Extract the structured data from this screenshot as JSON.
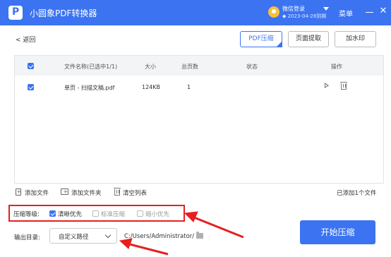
{
  "window": {
    "app_title": "小圆象PDF转换器",
    "user": {
      "login_text": "微信登录",
      "expire_text": "◆ 2023-04-28到期"
    },
    "menu_label": "菜单",
    "close_glyph": "✕"
  },
  "toolbar": {
    "back_label": "< 返回",
    "tabs": [
      {
        "label": "PDF压缩",
        "active": true
      },
      {
        "label": "页面提取",
        "active": false
      },
      {
        "label": "加水印",
        "active": false
      }
    ]
  },
  "table": {
    "columns": [
      "文件名称(已选中1/1)",
      "大小",
      "总页数",
      "状态",
      "操作"
    ],
    "rows": [
      {
        "checked": true,
        "name": "单页 - 扫描文稿.pdf",
        "size": "124KB",
        "pages": "1",
        "status": ""
      }
    ]
  },
  "file_actions": {
    "add_file": "添加文件",
    "add_folder": "添加文件夹",
    "clear_list": "清空列表",
    "added_count": "已添加1个文件"
  },
  "compression": {
    "label": "压缩等级:",
    "options": [
      {
        "label": "清晰优先",
        "checked": true
      },
      {
        "label": "标准压缩",
        "checked": false
      },
      {
        "label": "缩小优先",
        "checked": false
      }
    ]
  },
  "output": {
    "label": "输出目录:",
    "mode": "自定义路径",
    "path": "C:/Users/Administrator/"
  },
  "start_button": "开始压缩",
  "colors": {
    "primary": "#3b73f1",
    "annotation_red": "#e62020"
  }
}
